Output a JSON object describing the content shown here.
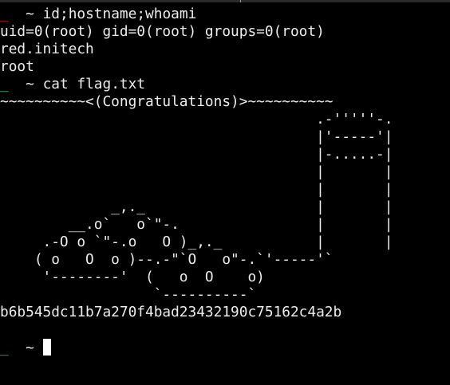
{
  "terminal": {
    "colors": {
      "background": "#000000",
      "text": "#ececec",
      "prompt_error": "#e01b24",
      "prompt_ok": "#33d17a"
    },
    "prompt_symbol": "_",
    "prompt_dir": "~",
    "commands": [
      {
        "command": "id;hostname;whoami",
        "status": "error"
      },
      {
        "command": "cat flag.txt",
        "status": "ok"
      }
    ],
    "output_id": "uid=0(root) gid=0(root) groups=0(root)",
    "output_hostname": "red.initech",
    "output_whoami": "root",
    "banner": "~~~~~~~~~~<(Congratulations)>~~~~~~~~~~",
    "ascii_art": "                                     .-'''''-.\n                                     |'-----'|\n                                     |-.....-|\n                                     |       |\n                                     |       |\n             _,._                    |       |\n        __.o`   o`\"-.                |       |\n     .-O o `\"-.o   O )_,._           |       |\n    ( o   O  o )--.-\"`O   o\"-.`'-----'`\n     '--------'  (   o  O    o)\n                  `----------`",
    "flag": "b6b545dc11b7a270f4bad23432190c75162c4a2b",
    "last_prompt_status": "ok"
  }
}
